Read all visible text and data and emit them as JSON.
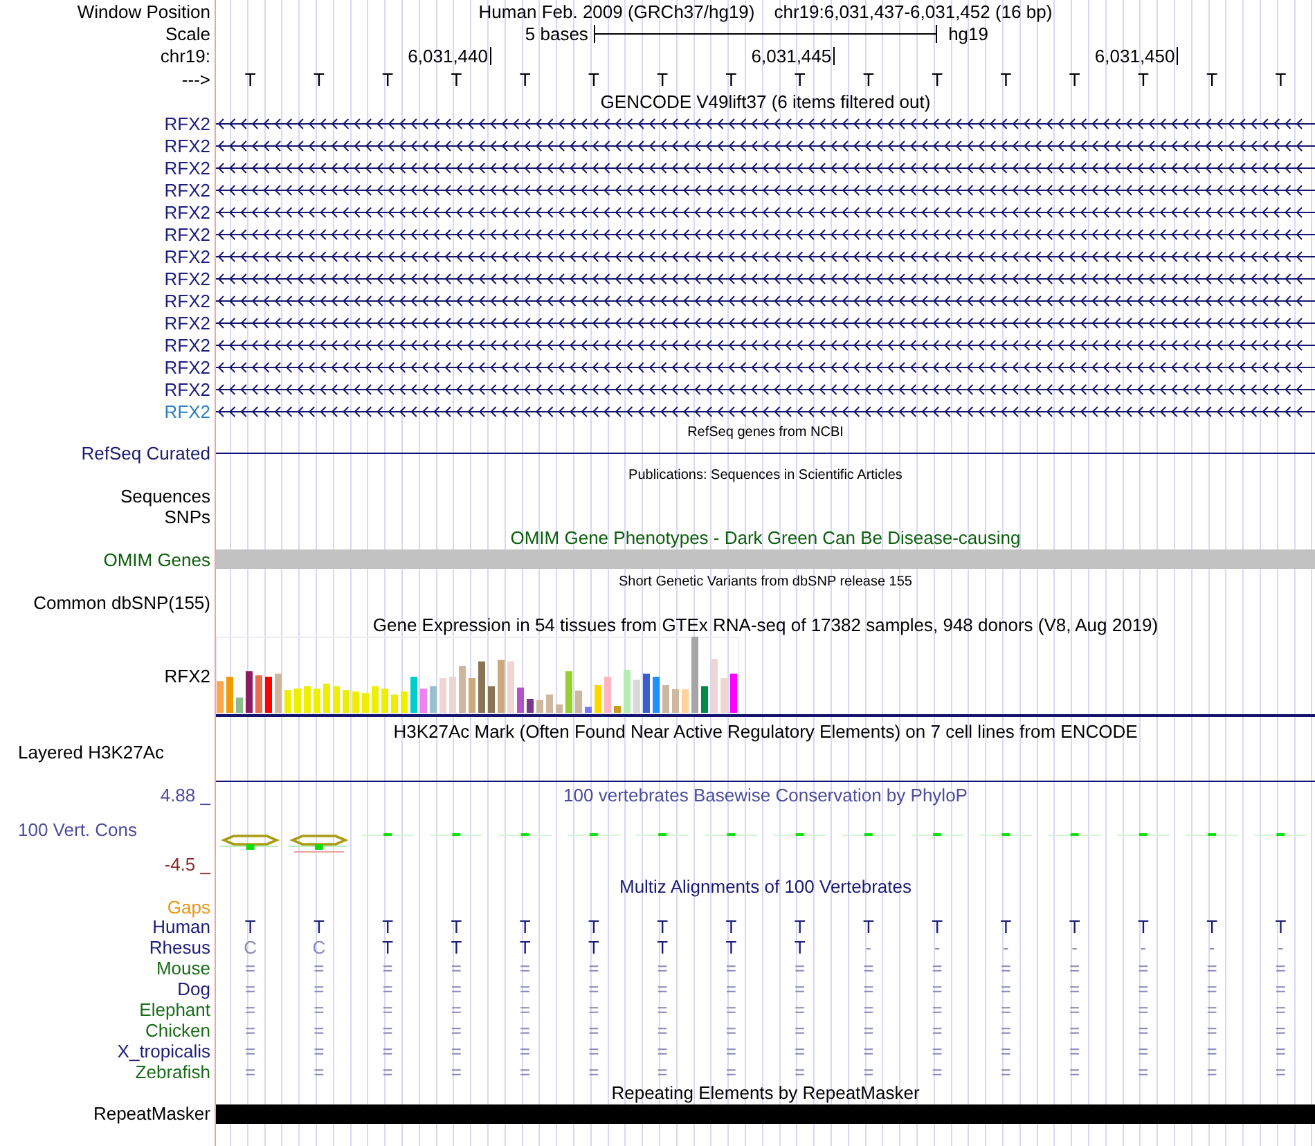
{
  "header": {
    "label": "Window Position",
    "assembly": "Human Feb. 2009 (GRCh37/hg19)",
    "position": "chr19:6,031,437-6,031,452 (16 bp)"
  },
  "scale": {
    "label": "Scale",
    "length": "5 bases",
    "assembly": "hg19"
  },
  "ruler": {
    "label": "chr19:",
    "ticks": [
      "6,031,440",
      "6,031,445",
      "6,031,450"
    ]
  },
  "sequence": {
    "label": "--->",
    "bases": [
      "T",
      "T",
      "T",
      "T",
      "T",
      "T",
      "T",
      "T",
      "T",
      "T",
      "T",
      "T",
      "T",
      "T",
      "T",
      "T"
    ]
  },
  "gencode": {
    "title": "GENCODE V49lift37 (6 items filtered out)",
    "genes": [
      {
        "name": "RFX2",
        "color": "#1c1c80"
      },
      {
        "name": "RFX2",
        "color": "#1c1c80"
      },
      {
        "name": "RFX2",
        "color": "#1c1c80"
      },
      {
        "name": "RFX2",
        "color": "#1c1c80"
      },
      {
        "name": "RFX2",
        "color": "#1c1c80"
      },
      {
        "name": "RFX2",
        "color": "#1c1c80"
      },
      {
        "name": "RFX2",
        "color": "#1c1c80"
      },
      {
        "name": "RFX2",
        "color": "#1c1c80"
      },
      {
        "name": "RFX2",
        "color": "#1c1c80"
      },
      {
        "name": "RFX2",
        "color": "#1c1c80"
      },
      {
        "name": "RFX2",
        "color": "#1c1c80"
      },
      {
        "name": "RFX2",
        "color": "#1c1c80"
      },
      {
        "name": "RFX2",
        "color": "#1c1c80"
      },
      {
        "name": "RFX2",
        "color": "#2a7ec4"
      }
    ]
  },
  "refseq": {
    "title": "RefSeq genes from NCBI",
    "label": "RefSeq Curated"
  },
  "publications": {
    "title": "Publications: Sequences in Scientific Articles",
    "labels": [
      "Sequences",
      "SNPs"
    ]
  },
  "omim": {
    "title": "OMIM Gene Phenotypes - Dark Green Can Be Disease-causing",
    "label": "OMIM Genes"
  },
  "dbsnp": {
    "title": "Short Genetic Variants from dbSNP release 155",
    "label": "Common dbSNP(155)"
  },
  "gtex": {
    "title": "Gene Expression in 54 tissues from GTEx RNA-seq of 17382 samples, 948 donors (V8, Aug 2019)",
    "gene": "RFX2"
  },
  "h3k27ac": {
    "title": "H3K27Ac Mark (Often Found Near Active Regulatory Elements) on 7 cell lines from ENCODE",
    "label": "Layered H3K27Ac"
  },
  "phylop": {
    "title": "100 vertebrates Basewise Conservation by PhyloP",
    "max": "4.88 _",
    "label": "100 Vert. Cons",
    "min": "-4.5 _"
  },
  "multiz": {
    "title": "Multiz Alignments of 100 Vertebrates",
    "gaps_label": "Gaps",
    "species": [
      {
        "name": "Human",
        "color": "#1c1c78",
        "bases": [
          {
            "text": "T",
            "match": true
          },
          {
            "text": "T",
            "match": true
          },
          {
            "text": "T",
            "match": true
          },
          {
            "text": "T",
            "match": true
          },
          {
            "text": "T",
            "match": true
          },
          {
            "text": "T",
            "match": true
          },
          {
            "text": "T",
            "match": true
          },
          {
            "text": "T",
            "match": true
          },
          {
            "text": "T",
            "match": true
          },
          {
            "text": "T",
            "match": true
          },
          {
            "text": "T",
            "match": true
          },
          {
            "text": "T",
            "match": true
          },
          {
            "text": "T",
            "match": true
          },
          {
            "text": "T",
            "match": true
          },
          {
            "text": "T",
            "match": true
          },
          {
            "text": "T",
            "match": true
          }
        ]
      },
      {
        "name": "Rhesus",
        "color": "#1c1c78",
        "bases": [
          {
            "text": "C",
            "match": false
          },
          {
            "text": "C",
            "match": false
          },
          {
            "text": "T",
            "match": true
          },
          {
            "text": "T",
            "match": true
          },
          {
            "text": "T",
            "match": true
          },
          {
            "text": "T",
            "match": true
          },
          {
            "text": "T",
            "match": true
          },
          {
            "text": "T",
            "match": true
          },
          {
            "text": "T",
            "match": true
          },
          {
            "text": "-",
            "match": false
          },
          {
            "text": "-",
            "match": false
          },
          {
            "text": "-",
            "match": false
          },
          {
            "text": "-",
            "match": false
          },
          {
            "text": "-",
            "match": false
          },
          {
            "text": "-",
            "match": false
          },
          {
            "text": "-",
            "match": false
          }
        ]
      },
      {
        "name": "Mouse",
        "color": "#176b17",
        "bases": [
          {
            "text": "=",
            "match": false
          },
          {
            "text": "=",
            "match": false
          },
          {
            "text": "=",
            "match": false
          },
          {
            "text": "=",
            "match": false
          },
          {
            "text": "=",
            "match": false
          },
          {
            "text": "=",
            "match": false
          },
          {
            "text": "=",
            "match": false
          },
          {
            "text": "=",
            "match": false
          },
          {
            "text": "=",
            "match": false
          },
          {
            "text": "=",
            "match": false
          },
          {
            "text": "=",
            "match": false
          },
          {
            "text": "=",
            "match": false
          },
          {
            "text": "=",
            "match": false
          },
          {
            "text": "=",
            "match": false
          },
          {
            "text": "=",
            "match": false
          },
          {
            "text": "=",
            "match": false
          }
        ]
      },
      {
        "name": "Dog",
        "color": "#1c1c78",
        "bases": [
          {
            "text": "=",
            "match": false
          },
          {
            "text": "=",
            "match": false
          },
          {
            "text": "=",
            "match": false
          },
          {
            "text": "=",
            "match": false
          },
          {
            "text": "=",
            "match": false
          },
          {
            "text": "=",
            "match": false
          },
          {
            "text": "=",
            "match": false
          },
          {
            "text": "=",
            "match": false
          },
          {
            "text": "=",
            "match": false
          },
          {
            "text": "=",
            "match": false
          },
          {
            "text": "=",
            "match": false
          },
          {
            "text": "=",
            "match": false
          },
          {
            "text": "=",
            "match": false
          },
          {
            "text": "=",
            "match": false
          },
          {
            "text": "=",
            "match": false
          },
          {
            "text": "=",
            "match": false
          }
        ]
      },
      {
        "name": "Elephant",
        "color": "#176b17",
        "bases": [
          {
            "text": "=",
            "match": false
          },
          {
            "text": "=",
            "match": false
          },
          {
            "text": "=",
            "match": false
          },
          {
            "text": "=",
            "match": false
          },
          {
            "text": "=",
            "match": false
          },
          {
            "text": "=",
            "match": false
          },
          {
            "text": "=",
            "match": false
          },
          {
            "text": "=",
            "match": false
          },
          {
            "text": "=",
            "match": false
          },
          {
            "text": "=",
            "match": false
          },
          {
            "text": "=",
            "match": false
          },
          {
            "text": "=",
            "match": false
          },
          {
            "text": "=",
            "match": false
          },
          {
            "text": "=",
            "match": false
          },
          {
            "text": "=",
            "match": false
          },
          {
            "text": "=",
            "match": false
          }
        ]
      },
      {
        "name": "Chicken",
        "color": "#176b17",
        "bases": [
          {
            "text": "=",
            "match": false
          },
          {
            "text": "=",
            "match": false
          },
          {
            "text": "=",
            "match": false
          },
          {
            "text": "=",
            "match": false
          },
          {
            "text": "=",
            "match": false
          },
          {
            "text": "=",
            "match": false
          },
          {
            "text": "=",
            "match": false
          },
          {
            "text": "=",
            "match": false
          },
          {
            "text": "=",
            "match": false
          },
          {
            "text": "=",
            "match": false
          },
          {
            "text": "=",
            "match": false
          },
          {
            "text": "=",
            "match": false
          },
          {
            "text": "=",
            "match": false
          },
          {
            "text": "=",
            "match": false
          },
          {
            "text": "=",
            "match": false
          },
          {
            "text": "=",
            "match": false
          }
        ]
      },
      {
        "name": "X_tropicalis",
        "color": "#1c1c78",
        "bases": [
          {
            "text": "=",
            "match": false
          },
          {
            "text": "=",
            "match": false
          },
          {
            "text": "=",
            "match": false
          },
          {
            "text": "=",
            "match": false
          },
          {
            "text": "=",
            "match": false
          },
          {
            "text": "=",
            "match": false
          },
          {
            "text": "=",
            "match": false
          },
          {
            "text": "=",
            "match": false
          },
          {
            "text": "=",
            "match": false
          },
          {
            "text": "=",
            "match": false
          },
          {
            "text": "=",
            "match": false
          },
          {
            "text": "=",
            "match": false
          },
          {
            "text": "=",
            "match": false
          },
          {
            "text": "=",
            "match": false
          },
          {
            "text": "=",
            "match": false
          },
          {
            "text": "=",
            "match": false
          }
        ]
      },
      {
        "name": "Zebrafish",
        "color": "#176b17",
        "bases": [
          {
            "text": "=",
            "match": false
          },
          {
            "text": "=",
            "match": false
          },
          {
            "text": "=",
            "match": false
          },
          {
            "text": "=",
            "match": false
          },
          {
            "text": "=",
            "match": false
          },
          {
            "text": "=",
            "match": false
          },
          {
            "text": "=",
            "match": false
          },
          {
            "text": "=",
            "match": false
          },
          {
            "text": "=",
            "match": false
          },
          {
            "text": "=",
            "match": false
          },
          {
            "text": "=",
            "match": false
          },
          {
            "text": "=",
            "match": false
          },
          {
            "text": "=",
            "match": false
          },
          {
            "text": "=",
            "match": false
          },
          {
            "text": "=",
            "match": false
          },
          {
            "text": "=",
            "match": false
          }
        ]
      }
    ]
  },
  "repeatmasker": {
    "title": "Repeating Elements by RepeatMasker",
    "label": "RepeatMasker"
  }
}
